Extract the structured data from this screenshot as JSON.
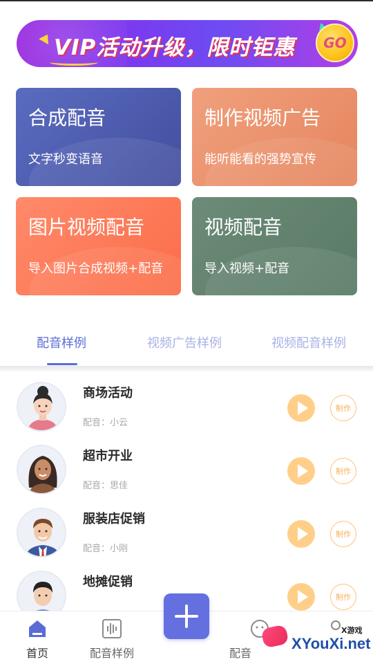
{
  "banner": {
    "text": "VIP活动升级，限时钜惠",
    "go_label": "GO"
  },
  "cards": [
    {
      "title": "合成配音",
      "subtitle": "文字秒变语音"
    },
    {
      "title": "制作视频广告",
      "subtitle": "能听能看的强势宣传"
    },
    {
      "title": "图片视频配音",
      "subtitle": "导入图片合成视频+配音"
    },
    {
      "title": "视频配音",
      "subtitle": "导入视频+配音"
    }
  ],
  "tabs": [
    {
      "label": "配音样例",
      "active": true
    },
    {
      "label": "视频广告样例",
      "active": false
    },
    {
      "label": "视频配音样例",
      "active": false
    }
  ],
  "samples": [
    {
      "title": "商场活动",
      "voice": "配音：小云",
      "make_label": "制作",
      "avatar": "woman-bun-avatar"
    },
    {
      "title": "超市开业",
      "voice": "配音：思佳",
      "make_label": "制作",
      "avatar": "woman-longhair-avatar"
    },
    {
      "title": "服装店促销",
      "voice": "配音：小刚",
      "make_label": "制作",
      "avatar": "man-suit-avatar"
    },
    {
      "title": "地摊促销",
      "voice": "",
      "make_label": "制作",
      "avatar": "man-shorthair-avatar"
    }
  ],
  "bottom_nav": {
    "home": "首页",
    "samples": "配音样例",
    "dub": "配音",
    "me": ""
  },
  "watermark": {
    "site": "XYouXi.net",
    "tag": "X游戏"
  },
  "colors": {
    "accent": "#5b6bd6",
    "play": "#ffcf8a",
    "make": "#f6b05a",
    "card1": "#4f5db0",
    "card2": "#ec9670",
    "card3": "#fd7b58",
    "card4": "#628270"
  }
}
